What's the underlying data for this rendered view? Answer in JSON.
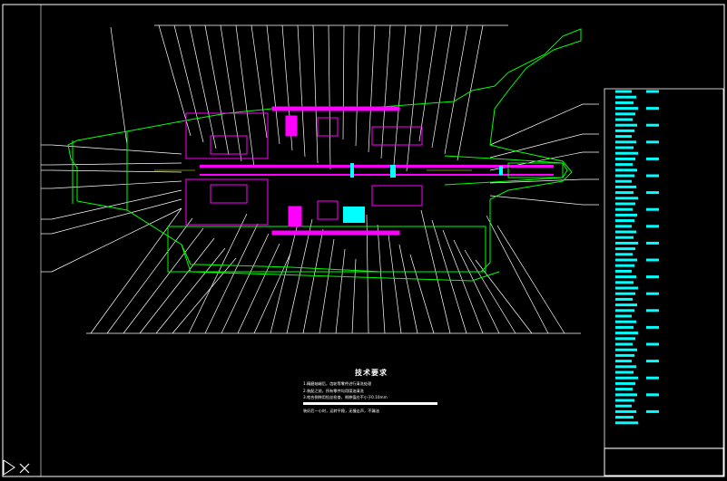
{
  "window": {
    "background": "#000000"
  },
  "colors": {
    "frame": "#ffffff",
    "outline": "#00ff00",
    "part": "#ff00ff",
    "leader": "#ffffff",
    "table_fill": "#00ffff",
    "section": "#ffff00"
  },
  "notes": {
    "title": "技术要求",
    "lines": [
      "1.精磨轴端后，齿轮等零件进行清洗处理",
      "2.装配之前，所有零件均用煤油清洗",
      "3.啮合侧隙用铅丝检查，侧隙值应不小于0.10mm",
      "装好后一小时，运转平稳，无撞击声，不漏油"
    ]
  },
  "icons": {
    "ucs": "ucs-axis-icon"
  }
}
